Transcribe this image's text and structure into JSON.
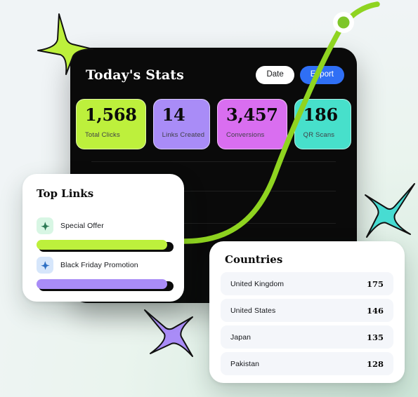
{
  "theme": {
    "bg_light": "#f0f4f6",
    "bg_mint": "#cfe8da",
    "panel_dark": "#0a0a0a",
    "accent_green": "#bdf03c",
    "accent_purple": "#a98cf7",
    "accent_magenta": "#d96ef0",
    "accent_teal": "#47e0cb",
    "accent_blue": "#2f6ff5",
    "curve_green": "#8fd420"
  },
  "dashboard": {
    "title": "Today's Stats",
    "buttons": {
      "date_label": "Date",
      "export_label": "Export"
    },
    "stats": [
      {
        "value": "1,568",
        "label": "Total Clicks",
        "color": "#bdf03c"
      },
      {
        "value": "14",
        "label": "Links Created",
        "color": "#a98cf7"
      },
      {
        "value": "3,457",
        "label": "Conversions",
        "color": "#d96ef0"
      },
      {
        "value": "186",
        "label": "QR Scans",
        "color": "#47e0cb"
      }
    ]
  },
  "top_links": {
    "title": "Top Links",
    "items": [
      {
        "name": "Special Offer",
        "icon": "sparkle-icon",
        "icon_bg": "#d8f6e4",
        "icon_color": "#2c7a55",
        "bar_color": "#bdf03c",
        "bar_percent": 97
      },
      {
        "name": "Black Friday Promotion",
        "icon": "sparkle-icon",
        "icon_bg": "#d6e6fb",
        "icon_color": "#2e6fc4",
        "bar_color": "#a98cf7",
        "bar_percent": 97
      }
    ]
  },
  "countries": {
    "title": "Countries",
    "rows": [
      {
        "name": "United Kingdom",
        "value": "175"
      },
      {
        "name": "United States",
        "value": "146"
      },
      {
        "name": "Japan",
        "value": "135"
      },
      {
        "name": "Pakistan",
        "value": "128"
      }
    ]
  },
  "decorations": {
    "sparkles": [
      {
        "name": "sparkle-green",
        "fill": "#bdf03c"
      },
      {
        "name": "sparkle-teal",
        "fill": "#47dcd2"
      },
      {
        "name": "sparkle-purple",
        "fill": "#a98cf7"
      }
    ],
    "curve_marker": {
      "name": "curve-end-marker",
      "fill": "#7ec62a",
      "ring": "#ffffff"
    }
  }
}
